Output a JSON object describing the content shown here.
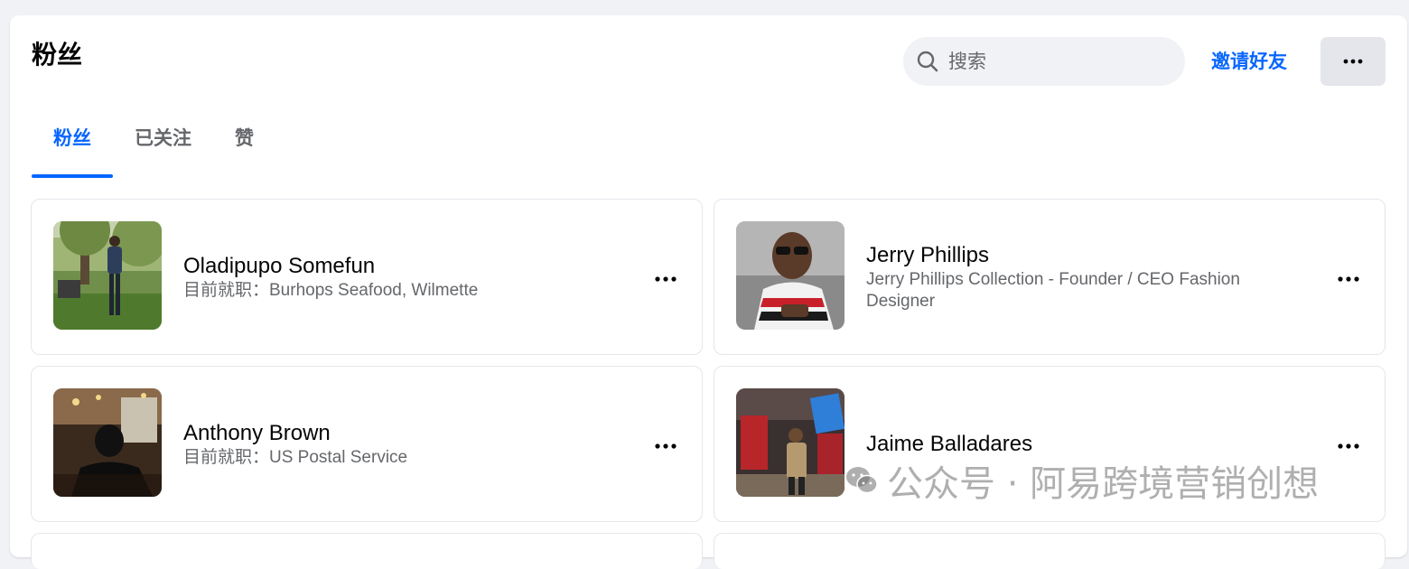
{
  "header": {
    "title": "粉丝",
    "search_placeholder": "搜索",
    "invite_label": "邀请好友",
    "more_icon": "more-horizontal-icon"
  },
  "tabs": [
    {
      "label": "粉丝",
      "active": true
    },
    {
      "label": "已关注",
      "active": false
    },
    {
      "label": "赞",
      "active": false
    }
  ],
  "cards": [
    {
      "name": "Oladipupo Somefun",
      "subtitle": "目前就职：Burhops Seafood, Wilmette"
    },
    {
      "name": "Jerry Phillips",
      "subtitle": "Jerry Phillips Collection - Founder / CEO Fashion Designer"
    },
    {
      "name": "Anthony Brown",
      "subtitle": "目前就职：US Postal Service"
    },
    {
      "name": "Jaime Balladares",
      "subtitle": ""
    }
  ],
  "watermark": {
    "text": "公众号 · 阿易跨境营销创想",
    "icon": "wechat-icon"
  },
  "colors": {
    "accent": "#0866ff",
    "page_bg": "#f0f2f5",
    "secondary_text": "#65676b"
  }
}
